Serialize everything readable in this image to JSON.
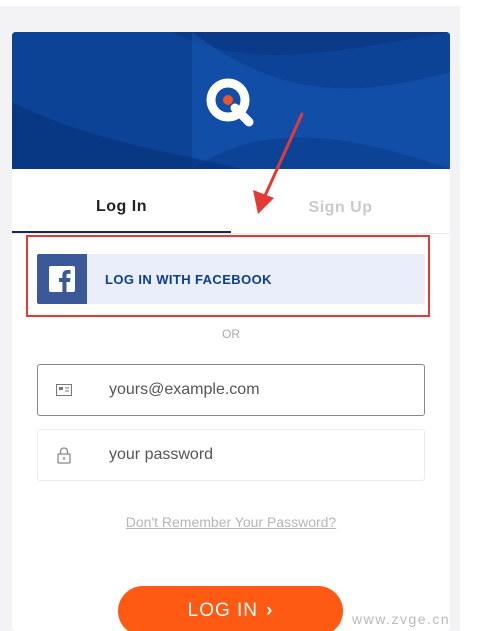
{
  "logo": {
    "icon": "search-q-logo-icon",
    "accent": "#e8562a"
  },
  "tabs": {
    "login": "Log In",
    "signup": "Sign Up"
  },
  "facebook": {
    "label": "LOG IN WITH FACEBOOK",
    "icon": "facebook-icon",
    "color": "#3b5998"
  },
  "divider": "OR",
  "email": {
    "placeholder": "yours@example.com",
    "icon": "envelope-icon"
  },
  "password": {
    "placeholder": "your password",
    "icon": "lock-icon"
  },
  "forgot_link": "Don't Remember Your Password?",
  "submit": {
    "label": "LOG IN",
    "chevron": "›",
    "color": "#ff5a14"
  },
  "watermark": "www.zvge.cn",
  "colors": {
    "hero": "#0b3d8f",
    "highlight": "#e53935",
    "arrow": "#e53935"
  }
}
